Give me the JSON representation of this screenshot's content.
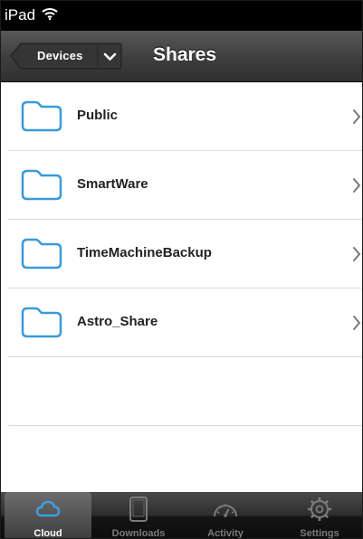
{
  "status_bar": {
    "label": "iPad"
  },
  "nav": {
    "back_label": "Devices",
    "title": "Shares"
  },
  "shares": [
    {
      "label": "Public"
    },
    {
      "label": "SmartWare"
    },
    {
      "label": "TimeMachineBackup"
    },
    {
      "label": "Astro_Share"
    }
  ],
  "tabs": [
    {
      "label": "Cloud",
      "icon": "cloud-icon",
      "active": true
    },
    {
      "label": "Downloads",
      "icon": "device-icon",
      "active": false
    },
    {
      "label": "Activity",
      "icon": "gauge-icon",
      "active": false
    },
    {
      "label": "Settings",
      "icon": "gear-icon",
      "active": false
    }
  ],
  "colors": {
    "folder_outline": "#3a9ad9",
    "active_tab_icon": "#3f9fe0"
  }
}
